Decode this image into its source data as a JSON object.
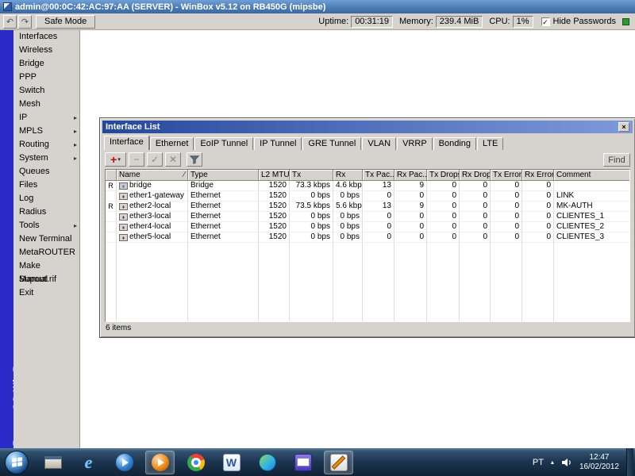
{
  "titlebar": {
    "title": "admin@00:0C:42:AC:97:AA (SERVER) - WinBox v5.12 on RB450G (mipsbe)"
  },
  "toolbar": {
    "undo_icon": "↶",
    "redo_icon": "↷",
    "safe_mode_label": "Safe Mode",
    "uptime_label": "Uptime:",
    "uptime_value": "00:31:19",
    "memory_label": "Memory:",
    "memory_value": "239.4 MiB",
    "cpu_label": "CPU:",
    "cpu_value": "1%",
    "checkbox_glyph": "✓",
    "hide_passwords_label": "Hide Passwords"
  },
  "sidebar": {
    "brand": "RouterOS WinBox",
    "submenu_arrow": "▸",
    "items": [
      {
        "label": "Interfaces",
        "submenu": false
      },
      {
        "label": "Wireless",
        "submenu": false
      },
      {
        "label": "Bridge",
        "submenu": false
      },
      {
        "label": "PPP",
        "submenu": false
      },
      {
        "label": "Switch",
        "submenu": false
      },
      {
        "label": "Mesh",
        "submenu": false
      },
      {
        "label": "IP",
        "submenu": true
      },
      {
        "label": "MPLS",
        "submenu": true
      },
      {
        "label": "Routing",
        "submenu": true
      },
      {
        "label": "System",
        "submenu": true
      },
      {
        "label": "Queues",
        "submenu": false
      },
      {
        "label": "Files",
        "submenu": false
      },
      {
        "label": "Log",
        "submenu": false
      },
      {
        "label": "Radius",
        "submenu": false
      },
      {
        "label": "Tools",
        "submenu": true
      },
      {
        "label": "New Terminal",
        "submenu": false
      },
      {
        "label": "MetaROUTER",
        "submenu": false
      },
      {
        "label": "Make Supout.rif",
        "submenu": false
      },
      {
        "label": "Manual",
        "submenu": false
      },
      {
        "label": "Exit",
        "submenu": false
      }
    ]
  },
  "interface_list": {
    "title": "Interface List",
    "close_icon": "×",
    "tabs": [
      "Interface",
      "Ethernet",
      "EoIP Tunnel",
      "IP Tunnel",
      "GRE Tunnel",
      "VLAN",
      "VRRP",
      "Bonding",
      "LTE"
    ],
    "active_tab": "Interface",
    "toolbar": {
      "add_icon": "+",
      "dropdown_icon": "▾",
      "remove_icon": "−",
      "enable_icon": "✓",
      "disable_icon": "✕",
      "find_label": "Find"
    },
    "columns": {
      "name": "Name",
      "sort_indicator": "∕",
      "type": "Type",
      "l2mtu": "L2 MTU",
      "tx": "Tx",
      "rx": "Rx",
      "txp": "Tx Pac...",
      "rxp": "Rx Pac...",
      "txd": "Tx Drops",
      "rxd": "Rx Drops",
      "txe": "Tx Errors",
      "rxe": "Rx Errors",
      "comment": "Comment"
    },
    "rows": [
      {
        "flag": "R",
        "icon": "bridge",
        "name": "bridge",
        "type": "Bridge",
        "l2mtu": "1520",
        "tx": "73.3 kbps",
        "rx": "4.6 kbps",
        "txp": "13",
        "rxp": "9",
        "txd": "0",
        "rxd": "0",
        "txe": "0",
        "rxe": "0",
        "comment": ""
      },
      {
        "flag": "",
        "icon": "ethernet",
        "name": "ether1-gateway",
        "type": "Ethernet",
        "l2mtu": "1520",
        "tx": "0 bps",
        "rx": "0 bps",
        "txp": "0",
        "rxp": "0",
        "txd": "0",
        "rxd": "0",
        "txe": "0",
        "rxe": "0",
        "comment": "LINK"
      },
      {
        "flag": "R",
        "icon": "ethernet",
        "name": "ether2-local",
        "type": "Ethernet",
        "l2mtu": "1520",
        "tx": "73.5 kbps",
        "rx": "5.6 kbps",
        "txp": "13",
        "rxp": "9",
        "txd": "0",
        "rxd": "0",
        "txe": "0",
        "rxe": "0",
        "comment": "MK-AUTH"
      },
      {
        "flag": "",
        "icon": "ethernet",
        "name": "ether3-local",
        "type": "Ethernet",
        "l2mtu": "1520",
        "tx": "0 bps",
        "rx": "0 bps",
        "txp": "0",
        "rxp": "0",
        "txd": "0",
        "rxd": "0",
        "txe": "0",
        "rxe": "0",
        "comment": "CLIENTES_1"
      },
      {
        "flag": "",
        "icon": "ethernet",
        "name": "ether4-local",
        "type": "Ethernet",
        "l2mtu": "1520",
        "tx": "0 bps",
        "rx": "0 bps",
        "txp": "0",
        "rxp": "0",
        "txd": "0",
        "rxd": "0",
        "txe": "0",
        "rxe": "0",
        "comment": "CLIENTES_2"
      },
      {
        "flag": "",
        "icon": "ethernet",
        "name": "ether5-local",
        "type": "Ethernet",
        "l2mtu": "1520",
        "tx": "0 bps",
        "rx": "0 bps",
        "txp": "0",
        "rxp": "0",
        "txd": "0",
        "rxd": "0",
        "txe": "0",
        "rxe": "0",
        "comment": "CLIENTES_3"
      }
    ],
    "status": "6 items"
  },
  "taskbar": {
    "apps": [
      "window",
      "internet-explorer",
      "windows-media-player",
      "media-player",
      "chrome",
      "word",
      "messenger",
      "windows-live-mail",
      "paint"
    ],
    "tray": {
      "language": "PT",
      "expand_icon": "▴",
      "time": "12:47",
      "date": "16/02/2012"
    }
  },
  "colors": {
    "brand_strip": "#2a2ac8",
    "title_blue": "#4a7ab2",
    "window_title_blue": "#26489c",
    "status_green": "#2f9a2f",
    "add_red": "#c80000"
  }
}
